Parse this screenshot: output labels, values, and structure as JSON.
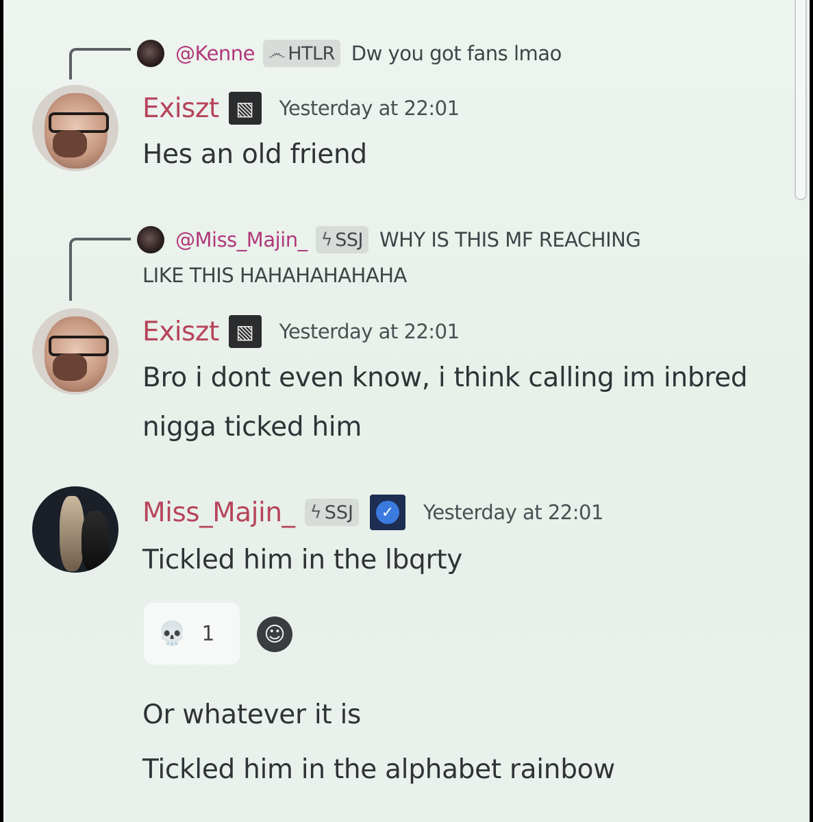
{
  "messages": [
    {
      "reply": {
        "mention": "@Kenne",
        "tag_icon": "෴",
        "tag": "HTLR",
        "text": "Dw you got fans lmao"
      },
      "username": "Exiszt",
      "badge_icon": "▧",
      "timestamp": "Yesterday at 22:01",
      "lines": [
        "Hes an old friend"
      ]
    },
    {
      "reply": {
        "mention": "@Miss_Majin_",
        "tag_icon": "ϟ",
        "tag": "SSJ",
        "text_line1": "WHY IS THIS MF REACHING",
        "text_line2": "LIKE THIS HAHAHAHAHAHA"
      },
      "username": "Exiszt",
      "badge_icon": "▧",
      "timestamp": "Yesterday at 22:01",
      "lines": [
        "Bro i dont even know, i think calling im inbred",
        "nigga ticked him"
      ]
    },
    {
      "username": "Miss_Majin_",
      "tag_icon": "ϟ",
      "tag": "SSJ",
      "verified_icon": "✓",
      "timestamp": "Yesterday at 22:01",
      "lines": [
        "Tickled him in the lbqrty"
      ],
      "reaction": {
        "emoji": "💀",
        "count": "1",
        "add_icon": "☺"
      },
      "followups": [
        "Or whatever it is",
        "Tickled him in the alphabet rainbow"
      ]
    }
  ]
}
